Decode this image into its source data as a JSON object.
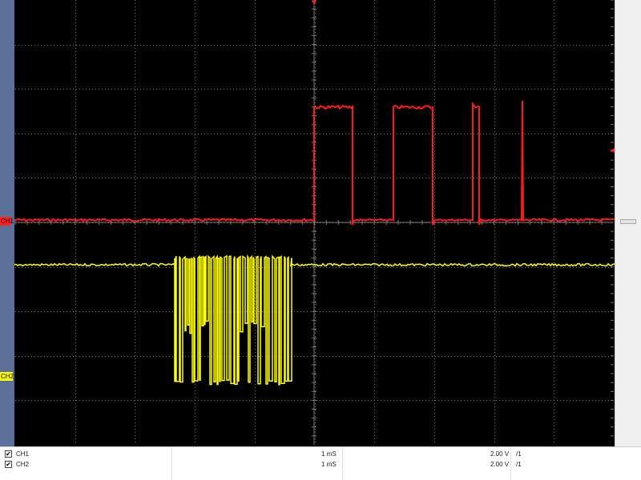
{
  "markers": {
    "ch1": "CH1",
    "ch2": "CH2"
  },
  "channels": [
    {
      "name": "CH1",
      "time_base": "1 mS",
      "volts_div": "2.00 V",
      "probe": "/1",
      "checked": true,
      "checkmark": "✔"
    },
    {
      "name": "CH2",
      "time_base": "1 mS",
      "volts_div": "2.00 V",
      "probe": "/1",
      "checked": true,
      "checkmark": "✔"
    }
  ],
  "colors": {
    "ch1": "#ff1a1a",
    "ch2": "#ffff00",
    "screen": "#000000",
    "grid": "#7a7a7a"
  },
  "icons": {
    "trigger_top": "triangle-down-icon",
    "trigger_right": "triangle-left-icon"
  }
}
